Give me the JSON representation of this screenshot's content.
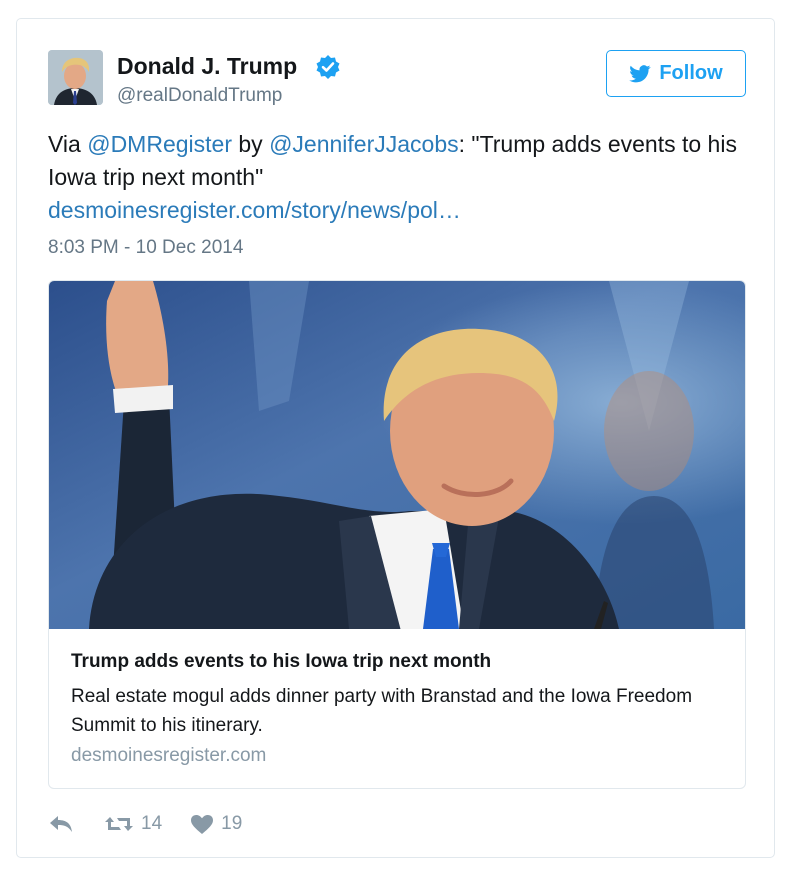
{
  "author": {
    "name": "Donald J. Trump",
    "handle": "@realDonaldTrump",
    "avatar_icon": "profile-photo",
    "verified_icon": "verified-badge-icon"
  },
  "follow_button": {
    "label": "Follow",
    "icon": "twitter-bird-icon"
  },
  "tweet": {
    "prefix": "Via ",
    "mention_1": "@DMRegister",
    "middle": " by ",
    "mention_2": "@JenniferJJacobs",
    "quote": ": \"Trump adds events to his Iowa trip next month\"",
    "url": "desmoinesregister.com/story/news/pol…",
    "timestamp": "8:03 PM - 10 Dec 2014"
  },
  "card": {
    "image_icon": "article-photo",
    "title": "Trump adds events to his Iowa trip next month",
    "description": "Real estate mogul adds dinner party with Branstad and the Iowa Freedom Summit to his itinerary.",
    "domain": "desmoinesregister.com"
  },
  "actions": {
    "reply_icon": "reply-icon",
    "retweet_icon": "retweet-icon",
    "retweet_count": "14",
    "like_icon": "heart-icon",
    "like_count": "19"
  },
  "colors": {
    "brand_blue": "#1da1f2",
    "link_blue": "#2b7bb9",
    "muted_gray": "#657786",
    "text_dark": "#14171a",
    "border": "#e1e8ed"
  }
}
